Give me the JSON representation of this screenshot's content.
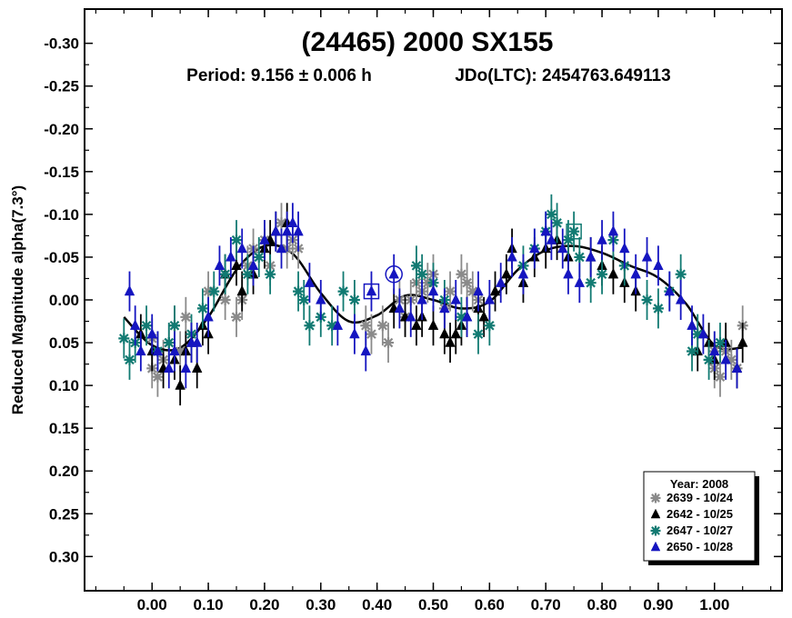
{
  "chart_data": {
    "type": "scatter",
    "title": "(24465) 2000 SX155",
    "subtitle_period": "Period: 9.156 ± 0.006 h",
    "subtitle_epoch": "JDo(LTC): 2454763.649113",
    "xlabel": "",
    "ylabel": "Reduced Magnitude alpha(7.3°)",
    "xlim": [
      -0.12,
      1.12
    ],
    "ylim": [
      0.34,
      -0.34
    ],
    "y_inverted": true,
    "grid": false,
    "legend_position": "bottom-right",
    "legend_title": "Year: 2008",
    "x_ticks": [
      0.0,
      0.1,
      0.2,
      0.3,
      0.4,
      0.5,
      0.6,
      0.7,
      0.8,
      0.9,
      1.0
    ],
    "x_tick_labels": [
      "0.00",
      "0.10",
      "0.20",
      "0.30",
      "0.40",
      "0.50",
      "0.60",
      "0.70",
      "0.80",
      "0.90",
      "1.00"
    ],
    "y_ticks": [
      -0.3,
      -0.25,
      -0.2,
      -0.15,
      -0.1,
      -0.05,
      0.0,
      0.05,
      0.1,
      0.15,
      0.2,
      0.25,
      0.3
    ],
    "y_tick_labels": [
      "-0.30",
      "-0.25",
      "-0.20",
      "-0.15",
      "-0.10",
      "-0.05",
      "0.00",
      "0.05",
      "0.10",
      "0.15",
      "0.20",
      "0.25",
      "0.30"
    ],
    "fit_curve": {
      "color": "#000000",
      "points": [
        [
          -0.05,
          0.02
        ],
        [
          0.0,
          0.053
        ],
        [
          0.05,
          0.056
        ],
        [
          0.1,
          0.02
        ],
        [
          0.15,
          -0.035
        ],
        [
          0.2,
          -0.063
        ],
        [
          0.25,
          -0.054
        ],
        [
          0.3,
          -0.008
        ],
        [
          0.35,
          0.025
        ],
        [
          0.4,
          0.018
        ],
        [
          0.45,
          -0.005
        ],
        [
          0.5,
          0.0
        ],
        [
          0.55,
          0.01
        ],
        [
          0.6,
          0.002
        ],
        [
          0.65,
          -0.035
        ],
        [
          0.7,
          -0.058
        ],
        [
          0.75,
          -0.063
        ],
        [
          0.8,
          -0.055
        ],
        [
          0.85,
          -0.04
        ],
        [
          0.9,
          -0.026
        ],
        [
          0.95,
          0.005
        ],
        [
          1.0,
          0.053
        ],
        [
          1.05,
          0.056
        ]
      ]
    },
    "series": [
      {
        "name": "2639 - 10/24",
        "marker": "asterisk",
        "color": "#8a8a8a",
        "points": [
          [
            0.0,
            0.045
          ],
          [
            0.0,
            0.08
          ],
          [
            0.01,
            0.06
          ],
          [
            0.01,
            0.09
          ],
          [
            0.02,
            0.07
          ],
          [
            0.03,
            0.05
          ],
          [
            0.04,
            0.03
          ],
          [
            0.05,
            0.06
          ],
          [
            0.06,
            0.02
          ],
          [
            0.1,
            -0.01
          ],
          [
            0.13,
            0.0
          ],
          [
            0.15,
            0.02
          ],
          [
            0.16,
            0.0
          ],
          [
            0.17,
            -0.04
          ],
          [
            0.18,
            -0.06
          ],
          [
            0.2,
            -0.07
          ],
          [
            0.21,
            -0.04
          ],
          [
            0.23,
            -0.09
          ],
          [
            0.24,
            -0.06
          ],
          [
            0.25,
            -0.07
          ],
          [
            0.26,
            -0.06
          ],
          [
            0.38,
            0.03
          ],
          [
            0.39,
            0.04
          ],
          [
            0.41,
            0.03
          ],
          [
            0.42,
            0.05
          ],
          [
            0.44,
            0.0
          ],
          [
            0.45,
            0.02
          ],
          [
            0.46,
            0.0
          ],
          [
            0.47,
            -0.02
          ],
          [
            0.48,
            -0.01
          ],
          [
            0.49,
            -0.02
          ],
          [
            0.5,
            -0.03
          ],
          [
            0.52,
            0.01
          ],
          [
            0.53,
            -0.01
          ],
          [
            0.55,
            -0.03
          ],
          [
            0.56,
            -0.02
          ],
          [
            0.57,
            -0.01
          ],
          [
            0.58,
            0.0
          ],
          [
            1.0,
            0.06
          ],
          [
            1.0,
            0.08
          ],
          [
            1.01,
            0.09
          ],
          [
            1.02,
            0.06
          ],
          [
            1.03,
            0.07
          ],
          [
            1.04,
            0.08
          ],
          [
            1.05,
            0.03
          ]
        ]
      },
      {
        "name": "2642 - 10/25",
        "marker": "triangle",
        "color": "#000000",
        "points": [
          [
            -0.02,
            0.04
          ],
          [
            0.0,
            0.06
          ],
          [
            0.02,
            0.08
          ],
          [
            0.04,
            0.07
          ],
          [
            0.05,
            0.1
          ],
          [
            0.06,
            0.06
          ],
          [
            0.07,
            0.05
          ],
          [
            0.08,
            0.08
          ],
          [
            0.09,
            0.03
          ],
          [
            0.1,
            0.04
          ],
          [
            0.13,
            -0.03
          ],
          [
            0.15,
            -0.04
          ],
          [
            0.16,
            -0.01
          ],
          [
            0.18,
            -0.03
          ],
          [
            0.2,
            -0.06
          ],
          [
            0.21,
            -0.07
          ],
          [
            0.22,
            -0.08
          ],
          [
            0.24,
            -0.09
          ],
          [
            0.43,
            0.01
          ],
          [
            0.45,
            0.02
          ],
          [
            0.47,
            0.03
          ],
          [
            0.48,
            0.02
          ],
          [
            0.5,
            0.03
          ],
          [
            0.52,
            0.04
          ],
          [
            0.53,
            0.05
          ],
          [
            0.54,
            0.04
          ],
          [
            0.55,
            0.03
          ],
          [
            0.56,
            0.02
          ],
          [
            0.58,
            0.01
          ],
          [
            0.59,
            0.02
          ],
          [
            0.61,
            -0.01
          ],
          [
            0.63,
            -0.03
          ],
          [
            0.64,
            -0.06
          ],
          [
            0.66,
            -0.02
          ],
          [
            0.68,
            -0.05
          ],
          [
            0.7,
            -0.06
          ],
          [
            0.72,
            -0.07
          ],
          [
            0.74,
            -0.05
          ],
          [
            0.78,
            -0.05
          ],
          [
            0.8,
            -0.04
          ],
          [
            0.82,
            -0.03
          ],
          [
            0.84,
            -0.02
          ],
          [
            0.86,
            -0.01
          ],
          [
            0.97,
            0.06
          ],
          [
            0.99,
            0.05
          ],
          [
            1.0,
            0.07
          ],
          [
            1.02,
            0.05
          ],
          [
            1.04,
            0.08
          ],
          [
            1.05,
            0.05
          ]
        ]
      },
      {
        "name": "2647 - 10/27",
        "marker": "asterisk",
        "color": "#117a72",
        "points": [
          [
            -0.05,
            0.045
          ],
          [
            -0.04,
            0.07
          ],
          [
            -0.03,
            0.05
          ],
          [
            -0.01,
            0.03
          ],
          [
            0.01,
            0.06
          ],
          [
            0.03,
            0.05
          ],
          [
            0.04,
            0.03
          ],
          [
            0.07,
            0.04
          ],
          [
            0.09,
            0.01
          ],
          [
            0.11,
            -0.01
          ],
          [
            0.13,
            -0.03
          ],
          [
            0.15,
            -0.07
          ],
          [
            0.17,
            -0.03
          ],
          [
            0.19,
            -0.05
          ],
          [
            0.21,
            -0.03
          ],
          [
            0.26,
            -0.01
          ],
          [
            0.27,
            0.0
          ],
          [
            0.28,
            0.03
          ],
          [
            0.3,
            0.02
          ],
          [
            0.32,
            0.03
          ],
          [
            0.34,
            -0.01
          ],
          [
            0.36,
            0.0
          ],
          [
            0.47,
            -0.04
          ],
          [
            0.48,
            -0.03
          ],
          [
            0.5,
            -0.02
          ],
          [
            0.52,
            0.0
          ],
          [
            0.55,
            0.02
          ],
          [
            0.58,
            0.04
          ],
          [
            0.6,
            0.03
          ],
          [
            0.66,
            -0.04
          ],
          [
            0.68,
            -0.06
          ],
          [
            0.7,
            -0.08
          ],
          [
            0.71,
            -0.1
          ],
          [
            0.72,
            -0.09
          ],
          [
            0.74,
            -0.07
          ],
          [
            0.75,
            -0.08
          ],
          [
            0.76,
            -0.05
          ],
          [
            0.78,
            -0.02
          ],
          [
            0.8,
            -0.03
          ],
          [
            0.82,
            -0.07
          ],
          [
            0.84,
            -0.04
          ],
          [
            0.88,
            0.0
          ],
          [
            0.9,
            0.01
          ],
          [
            0.92,
            -0.01
          ],
          [
            0.94,
            -0.03
          ],
          [
            0.96,
            0.06
          ],
          [
            0.97,
            0.04
          ],
          [
            0.99,
            0.07
          ],
          [
            1.01,
            0.05
          ]
        ]
      },
      {
        "name": "2650 - 10/28",
        "marker": "triangle",
        "color": "#1515c0",
        "points": [
          [
            -0.04,
            -0.01
          ],
          [
            -0.03,
            0.03
          ],
          [
            -0.02,
            0.06
          ],
          [
            0.0,
            0.04
          ],
          [
            0.01,
            0.06
          ],
          [
            0.03,
            0.08
          ],
          [
            0.04,
            0.06
          ],
          [
            0.06,
            0.08
          ],
          [
            0.07,
            0.05
          ],
          [
            0.08,
            0.05
          ],
          [
            0.1,
            0.02
          ],
          [
            0.12,
            -0.04
          ],
          [
            0.14,
            -0.05
          ],
          [
            0.16,
            -0.06
          ],
          [
            0.18,
            -0.04
          ],
          [
            0.2,
            -0.07
          ],
          [
            0.22,
            -0.08
          ],
          [
            0.23,
            -0.06
          ],
          [
            0.24,
            -0.08
          ],
          [
            0.25,
            -0.09
          ],
          [
            0.26,
            -0.08
          ],
          [
            0.28,
            -0.02
          ],
          [
            0.3,
            0.0
          ],
          [
            0.33,
            0.03
          ],
          [
            0.36,
            0.04
          ],
          [
            0.38,
            0.06
          ],
          [
            0.39,
            -0.01
          ],
          [
            0.43,
            -0.03
          ],
          [
            0.44,
            0.01
          ],
          [
            0.46,
            0.02
          ],
          [
            0.48,
            0.0
          ],
          [
            0.5,
            -0.01
          ],
          [
            0.52,
            0.01
          ],
          [
            0.54,
            0.0
          ],
          [
            0.56,
            0.02
          ],
          [
            0.58,
            -0.01
          ],
          [
            0.6,
            0.0
          ],
          [
            0.62,
            -0.02
          ],
          [
            0.64,
            -0.05
          ],
          [
            0.66,
            -0.03
          ],
          [
            0.68,
            -0.06
          ],
          [
            0.7,
            -0.08
          ],
          [
            0.71,
            -0.07
          ],
          [
            0.73,
            -0.06
          ],
          [
            0.74,
            -0.03
          ],
          [
            0.76,
            -0.02
          ],
          [
            0.78,
            -0.05
          ],
          [
            0.8,
            -0.07
          ],
          [
            0.82,
            -0.08
          ],
          [
            0.84,
            -0.06
          ],
          [
            0.86,
            -0.03
          ],
          [
            0.88,
            -0.05
          ],
          [
            0.9,
            -0.04
          ],
          [
            0.92,
            -0.01
          ],
          [
            0.94,
            0.0
          ],
          [
            0.96,
            0.03
          ],
          [
            0.98,
            0.04
          ],
          [
            1.0,
            0.06
          ],
          [
            1.02,
            0.07
          ],
          [
            1.04,
            0.08
          ]
        ]
      }
    ],
    "outlined_points": [
      {
        "series": 3,
        "x": 0.39,
        "y": -0.01,
        "shape": "square"
      },
      {
        "series": 3,
        "x": 0.43,
        "y": -0.03,
        "shape": "circle"
      },
      {
        "series": 2,
        "x": 0.75,
        "y": -0.08,
        "shape": "square"
      }
    ]
  }
}
